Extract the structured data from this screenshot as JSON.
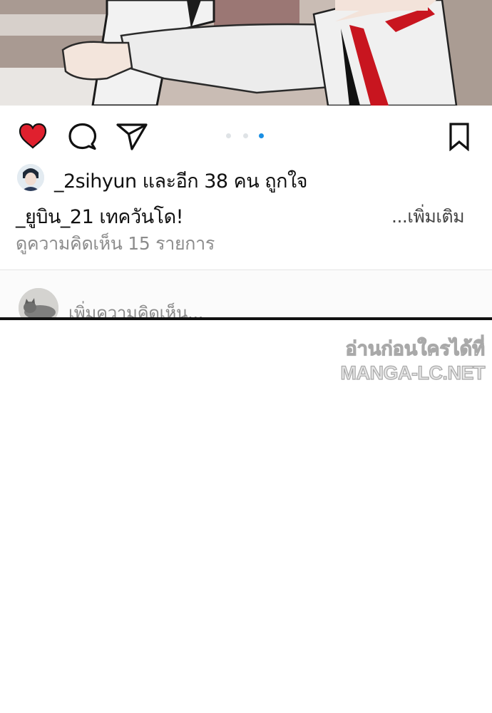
{
  "post": {
    "likes_text": "_2sihyun และอีก 38 คน ถูกใจ",
    "caption": "_ยูบิน_21 เทควันโด!",
    "more_label": "...เพิ่มเติม",
    "view_comments": "ดูความคิดเห็น 15 รายการ",
    "carousel": {
      "count": 3,
      "active_index": 2
    }
  },
  "comment_box": {
    "placeholder": "เพิ่มความคิดเห็น..."
  },
  "watermark": {
    "line1": "อ่านก่อนใครได้ที่",
    "line2": "MANGA-LC.NET"
  },
  "colors": {
    "like_red": "#e0202e",
    "active_dot": "#1a8fe3",
    "inactive_dot": "#dfe3e6"
  },
  "icons": [
    "heart-icon",
    "comment-icon",
    "share-icon",
    "bookmark-icon"
  ]
}
